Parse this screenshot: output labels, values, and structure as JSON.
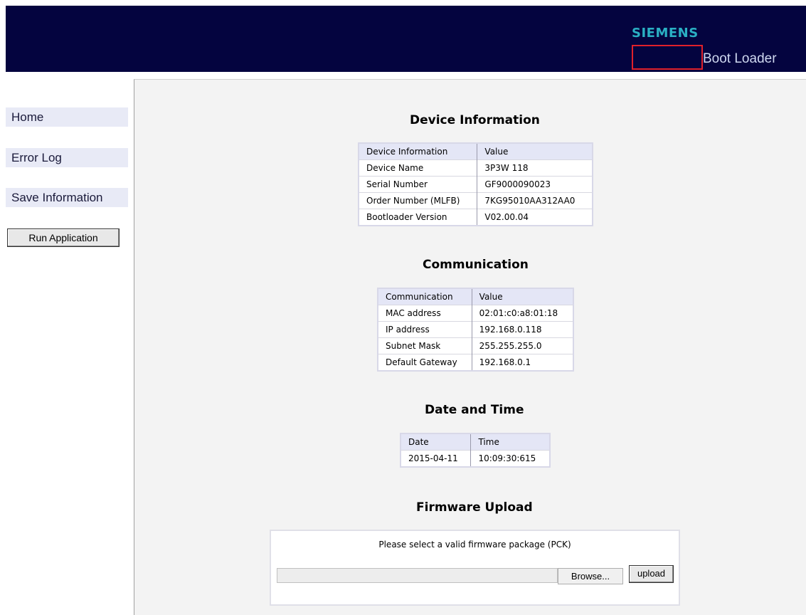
{
  "header": {
    "brand": "SIEMENS",
    "product": "Boot Loader",
    "colors": {
      "background": "#04043f",
      "brand": "#2ab0c4",
      "highlight_box": "#e0202a"
    }
  },
  "sidebar": {
    "items": [
      {
        "label": "Home"
      },
      {
        "label": "Error Log"
      },
      {
        "label": "Save Information"
      }
    ],
    "run_button": "Run Application"
  },
  "device_info": {
    "title": "Device Information",
    "headers": [
      "Device Information",
      "Value"
    ],
    "rows": [
      [
        "Device Name",
        "3P3W 118"
      ],
      [
        "Serial Number",
        "GF9000090023"
      ],
      [
        "Order Number (MLFB)",
        "7KG95010AA312AA0"
      ],
      [
        "Bootloader Version",
        "V02.00.04"
      ]
    ]
  },
  "communication": {
    "title": "Communication",
    "headers": [
      "Communication",
      "Value"
    ],
    "rows": [
      [
        "MAC address",
        "02:01:c0:a8:01:18"
      ],
      [
        "IP address",
        "192.168.0.118"
      ],
      [
        "Subnet Mask",
        "255.255.255.0"
      ],
      [
        "Default Gateway",
        "192.168.0.1"
      ]
    ]
  },
  "datetime": {
    "title": "Date and Time",
    "headers": [
      "Date",
      "Time"
    ],
    "rows": [
      [
        "2015-04-11",
        "10:09:30:615"
      ]
    ]
  },
  "firmware": {
    "title": "Firmware Upload",
    "message": "Please select a valid firmware package (PCK)",
    "file_value": "",
    "browse_label": "Browse...",
    "upload_label": "upload"
  }
}
